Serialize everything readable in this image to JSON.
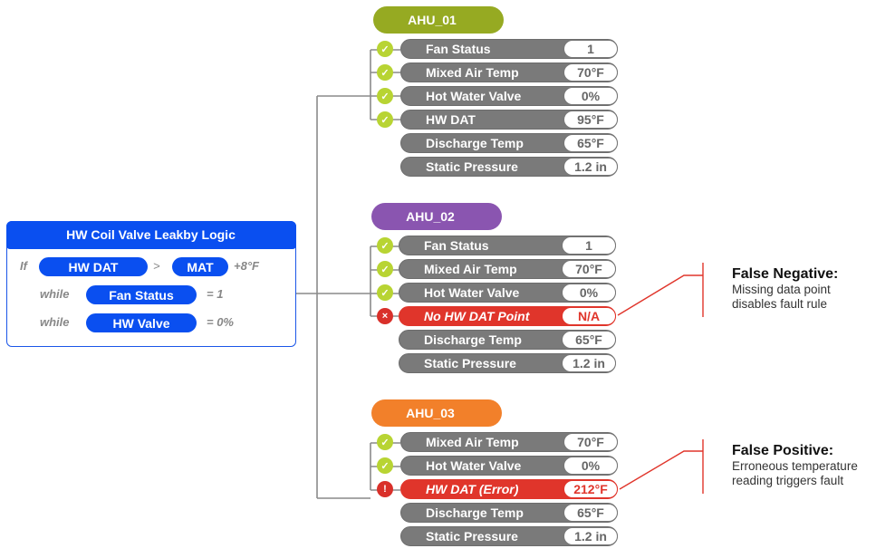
{
  "logic": {
    "title": "HW Coil Valve Leakby Logic",
    "if_kw": "If",
    "lhs": "HW DAT",
    "op": ">",
    "rhs": "MAT",
    "offset": "+8°F",
    "conditions": [
      {
        "kw": "while",
        "point": "Fan Status",
        "value": "= 1"
      },
      {
        "kw": "while",
        "point": "HW Valve",
        "value": "= 0%"
      }
    ],
    "accent": "#0a4ff0"
  },
  "ahus": [
    {
      "name": "AHU_01",
      "color": "#96aa22",
      "rows": [
        {
          "label": "Fan Status",
          "value": "1",
          "status": "ok",
          "icon": "✓"
        },
        {
          "label": "Mixed Air Temp",
          "value": "70°F",
          "status": "ok",
          "icon": "✓"
        },
        {
          "label": "Hot Water Valve",
          "value": "0%",
          "status": "ok",
          "icon": "✓"
        },
        {
          "label": "HW DAT",
          "value": "95°F",
          "status": "ok",
          "icon": "✓"
        },
        {
          "label": "Discharge Temp",
          "value": "65°F",
          "status": "none",
          "icon": ""
        },
        {
          "label": "Static Pressure",
          "value": "1.2 in",
          "status": "none",
          "icon": ""
        }
      ]
    },
    {
      "name": "AHU_02",
      "color": "#8a55b0",
      "rows": [
        {
          "label": "Fan Status",
          "value": "1",
          "status": "ok",
          "icon": "✓"
        },
        {
          "label": "Mixed Air Temp",
          "value": "70°F",
          "status": "ok",
          "icon": "✓"
        },
        {
          "label": "Hot Water Valve",
          "value": "0%",
          "status": "ok",
          "icon": "✓"
        },
        {
          "label": "No HW DAT Point",
          "value": "N/A",
          "status": "error",
          "icon": "×"
        },
        {
          "label": "Discharge Temp",
          "value": "65°F",
          "status": "none",
          "icon": ""
        },
        {
          "label": "Static Pressure",
          "value": "1.2 in",
          "status": "none",
          "icon": ""
        }
      ]
    },
    {
      "name": "AHU_03",
      "color": "#f2802a",
      "rows": [
        {
          "label": "Mixed Air Temp",
          "value": "70°F",
          "status": "ok",
          "icon": "✓"
        },
        {
          "label": "Hot Water Valve",
          "value": "0%",
          "status": "ok",
          "icon": "✓"
        },
        {
          "label": "HW DAT (Error)",
          "value": "212°F",
          "status": "error",
          "icon": "!"
        },
        {
          "label": "Discharge Temp",
          "value": "65°F",
          "status": "none",
          "icon": ""
        },
        {
          "label": "Static Pressure",
          "value": "1.2 in",
          "status": "none",
          "icon": ""
        }
      ]
    }
  ],
  "notes": [
    {
      "title": "False Negative:",
      "line1": "Missing data point",
      "line2": "disables fault rule"
    },
    {
      "title": "False Positive:",
      "line1": "Erroneous temperature",
      "line2": "reading triggers fault"
    }
  ],
  "colors": {
    "ok": "#b8d433",
    "error": "#e0352b",
    "row": "#7a7a7a",
    "line": "#8a8a8a"
  }
}
